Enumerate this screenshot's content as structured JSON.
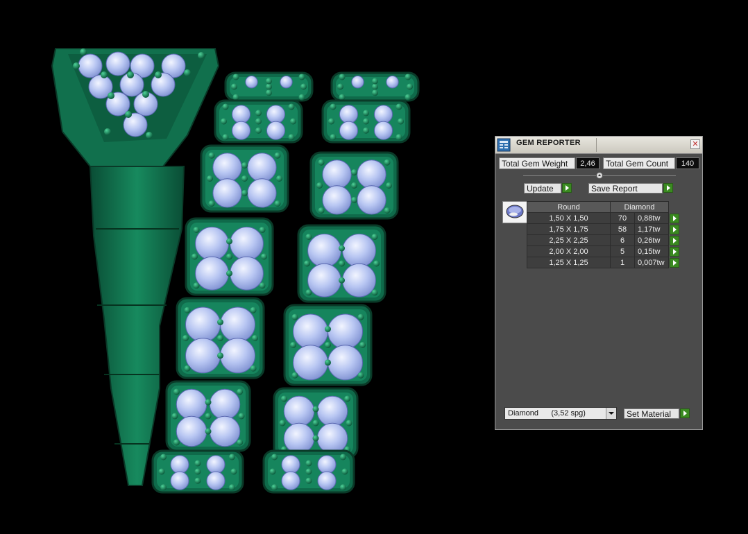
{
  "window": {
    "title": "GEM REPORTER",
    "close_icon": "close-icon",
    "app_icon": "gem-reporter-icon"
  },
  "stats": {
    "total_weight_label": "Total Gem Weight",
    "total_weight_value": "2,46",
    "total_count_label": "Total Gem Count",
    "total_count_value": "140"
  },
  "actions": {
    "update_label": "Update",
    "save_report_label": "Save Report",
    "set_material_label": "Set Material"
  },
  "table": {
    "headers": [
      "Round",
      "Diamond"
    ],
    "rows": [
      {
        "size": "1,50 X 1,50",
        "count": "70",
        "weight": "0,88tw"
      },
      {
        "size": "1,75 X 1,75",
        "count": "58",
        "weight": "1,17tw"
      },
      {
        "size": "2,25 X 2,25",
        "count": "6",
        "weight": "0,26tw"
      },
      {
        "size": "2,00 X 2,00",
        "count": "5",
        "weight": "0,15tw"
      },
      {
        "size": "1,25 X 1,25",
        "count": "1",
        "weight": "0,007tw"
      }
    ]
  },
  "material_select": {
    "value": "Diamond      (3,52 spg)"
  },
  "colors": {
    "panel_bg": "#4b4b4b",
    "accent_green": "#3a8a20",
    "model_green": "#0f6a4a",
    "gem_blue": "#b8c6f2"
  }
}
